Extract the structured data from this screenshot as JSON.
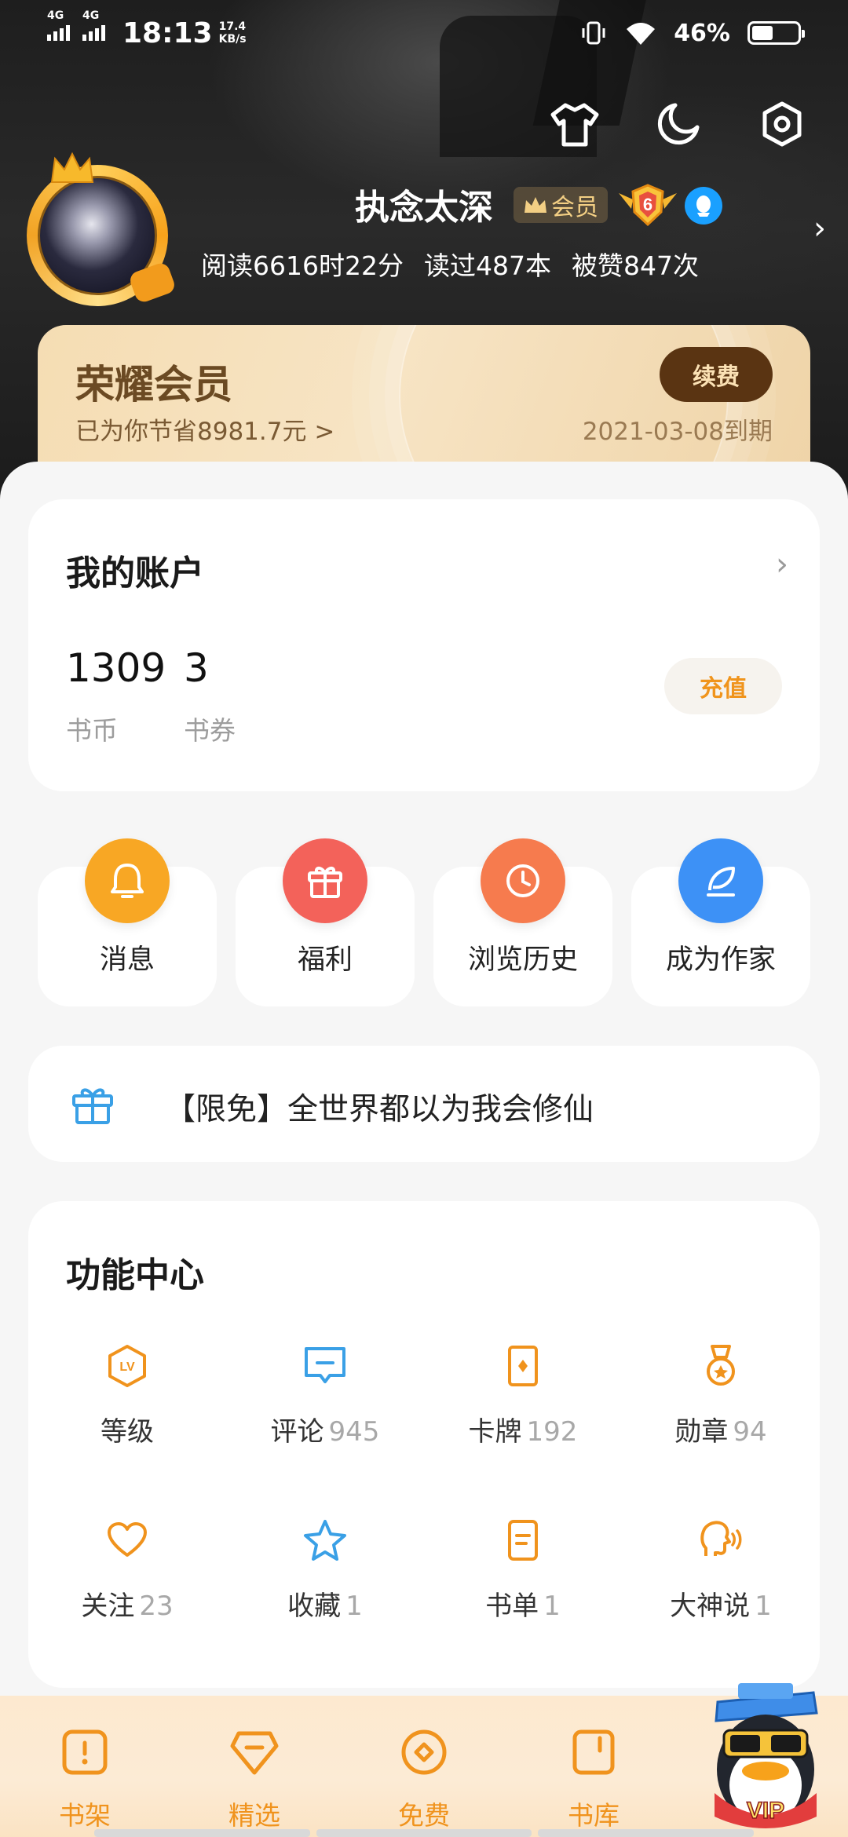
{
  "status_bar": {
    "net1": "4G",
    "net2": "4G",
    "time": "18:13",
    "speed_value": "17.4",
    "speed_unit": "KB/s",
    "battery": "46%",
    "battery_level": 0.46
  },
  "profile": {
    "username": "执念太深",
    "vip_tag": "会员",
    "level": "6",
    "stats": [
      "阅读6616时22分",
      "读过487本",
      "被赞847次"
    ]
  },
  "membership": {
    "title": "荣耀会员",
    "saved": "已为你节省8981.7元 >",
    "renew_label": "续费",
    "expiry": "2021-03-08到期"
  },
  "account": {
    "title": "我的账户",
    "coins_value": "1309",
    "coins_label": "书币",
    "vouchers_value": "3",
    "vouchers_label": "书券",
    "recharge_label": "充值"
  },
  "quick_actions": [
    {
      "label": "消息",
      "icon": "bell-icon",
      "color": "#f7a21b"
    },
    {
      "label": "福利",
      "icon": "gift-icon",
      "color": "#f2605a"
    },
    {
      "label": "浏览历史",
      "icon": "clock-icon",
      "color": "#f57a4c"
    },
    {
      "label": "成为作家",
      "icon": "quill-icon",
      "color": "#3b8ff5"
    }
  ],
  "promo": {
    "text": "【限免】全世界都以为我会修仙",
    "icon": "gift-icon"
  },
  "function_center": {
    "title": "功能中心",
    "items": [
      {
        "label": "等级",
        "count": "",
        "icon": "level-icon"
      },
      {
        "label": "评论",
        "count": "945",
        "icon": "comment-icon"
      },
      {
        "label": "卡牌",
        "count": "192",
        "icon": "card-icon"
      },
      {
        "label": "勋章",
        "count": "94",
        "icon": "medal-icon"
      },
      {
        "label": "关注",
        "count": "23",
        "icon": "heart-icon"
      },
      {
        "label": "收藏",
        "count": "1",
        "icon": "star-icon"
      },
      {
        "label": "书单",
        "count": "1",
        "icon": "booklist-icon"
      },
      {
        "label": "大神说",
        "count": "1",
        "icon": "speaker-icon"
      }
    ]
  },
  "bottom_nav": [
    {
      "label": "书架",
      "icon": "bookshelf-icon"
    },
    {
      "label": "精选",
      "icon": "diamond-icon"
    },
    {
      "label": "免费",
      "icon": "coin-icon"
    },
    {
      "label": "书库",
      "icon": "library-icon"
    }
  ],
  "mascot": {
    "badge": "VIP"
  },
  "colors": {
    "accent": "#f0931d",
    "brand_dark": "#5a3412",
    "blue": "#3aa0e6"
  }
}
